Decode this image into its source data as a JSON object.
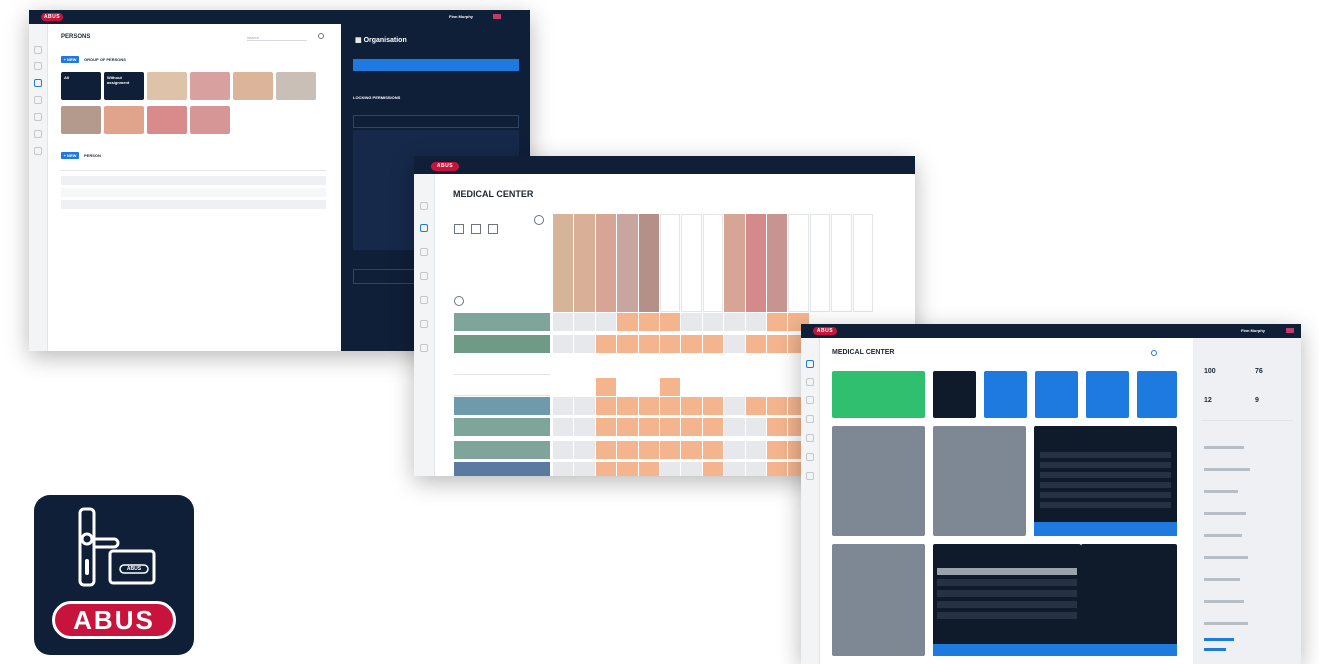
{
  "screen1": {
    "brand": "ABUS",
    "user": "Finn Murphy",
    "title": "PERSONS",
    "search_placeholder": "search",
    "add_label": "+ NEW",
    "groups_heading": "GROUP OF PERSONS",
    "group_tiles": [
      {
        "label": "All",
        "sub": "Persons",
        "color": "#0f1f38"
      },
      {
        "label": "Without assignment",
        "sub": "Persons",
        "color": "#0f1f38"
      },
      {
        "label": "",
        "sub": "",
        "color": "#dfc3a8"
      },
      {
        "label": "",
        "sub": "",
        "color": "#d9a0a0"
      },
      {
        "label": "",
        "sub": "",
        "color": "#dcb49a"
      },
      {
        "label": "",
        "sub": "",
        "color": "#c9bfb6"
      },
      {
        "label": "",
        "sub": "",
        "color": "#b39a8c"
      },
      {
        "label": "",
        "sub": "",
        "color": "#e0a48c"
      },
      {
        "label": "",
        "sub": "",
        "color": "#d98b8b"
      },
      {
        "label": "",
        "sub": "",
        "color": "#d79696"
      }
    ],
    "person_heading": "PERSON",
    "person_rows": [
      "",
      "",
      ""
    ],
    "panel": {
      "title": "Organisation",
      "dropdown": "",
      "perm_heading": "LOCKING PERMISSIONS",
      "item": "",
      "footer_item": ""
    }
  },
  "screen2": {
    "brand": "ABUS",
    "title": "MEDICAL CENTER",
    "subtitle": "",
    "column_colors": [
      "#d6b49a",
      "#d9b097",
      "#d7a596",
      "#c9a5a0",
      "#b59088",
      "#ffffff",
      "#ffffff",
      "#ffffff",
      "#d7a596",
      "#d58a8a",
      "#c8948f",
      "#ffffff",
      "#ffffff",
      "#ffffff",
      "#ffffff"
    ],
    "row_groups": [
      {
        "label": "",
        "color": "#7fa59a"
      },
      {
        "label": "",
        "color": "#6f9a86"
      },
      {
        "label": "",
        "color": "#ffffff"
      },
      {
        "label": "",
        "color": "#ffffff"
      },
      {
        "label": "",
        "color": "#6e9aab"
      },
      {
        "label": "",
        "color": "#7ea59a"
      },
      {
        "label": "",
        "color": "#7fa59a"
      },
      {
        "label": "",
        "color": "#5a7aa0"
      }
    ]
  },
  "screen3": {
    "brand": "ABUS",
    "user": "Finn Murphy",
    "title": "MEDICAL CENTER",
    "stats": [
      {
        "value": "100"
      },
      {
        "value": "76"
      },
      {
        "value": "12"
      },
      {
        "value": "9"
      }
    ],
    "action_tiles": [
      {
        "label": "",
        "color": "#2fbf6f"
      },
      {
        "label": "",
        "color": "#0f1a2a"
      },
      {
        "label": "",
        "color": "#1f7ae0"
      },
      {
        "label": "",
        "color": "#1f7ae0"
      },
      {
        "label": "",
        "color": "#1f7ae0"
      },
      {
        "label": "",
        "color": "#1f7ae0"
      }
    ],
    "cards": {
      "system_alerts": "",
      "battery_warning": "",
      "job_list": "",
      "relay_restriction": "",
      "log": "",
      "battery_warning_2": ""
    },
    "side_heading": ""
  },
  "logo": {
    "brand": "ABUS",
    "card_text": "ABUS",
    "bg": "#0f1f38",
    "red": "#c8143c"
  }
}
